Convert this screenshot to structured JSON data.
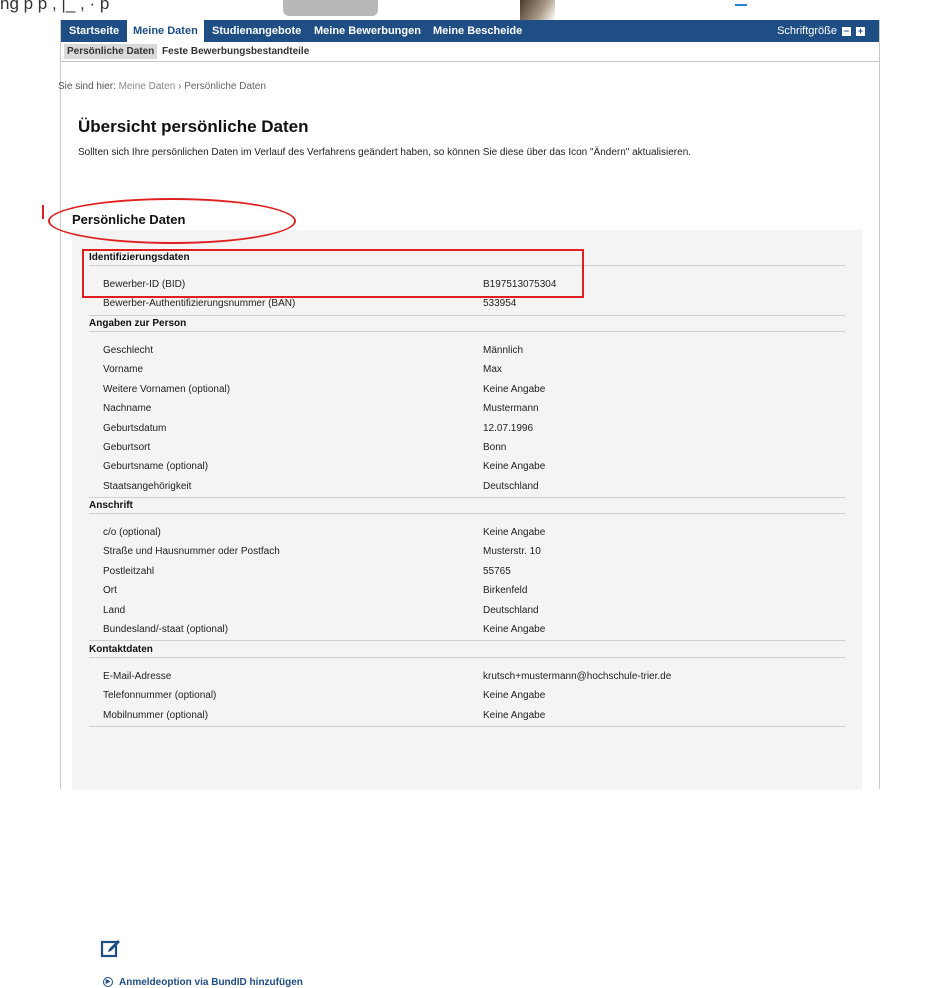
{
  "top_strip": {
    "partial_text": "ng  p                                                  p      ,      |_                 ,  ·                                  p"
  },
  "nav": {
    "items": [
      "Startseite",
      "Meine Daten",
      "Studienangebote",
      "Meine Bewerbungen",
      "Meine Bescheide"
    ],
    "active": "Meine Daten",
    "font_size_label": "Schriftgröße",
    "font_minus": "−",
    "font_plus": "+"
  },
  "subnav": {
    "items": [
      "Persönliche Daten",
      "Feste Bewerbungsbestandteile"
    ],
    "active": "Persönliche Daten"
  },
  "breadcrumb": {
    "label": "Sie sind hier:",
    "items": [
      "Meine Daten",
      "Persönliche Daten"
    ],
    "separator": "›"
  },
  "page": {
    "title": "Übersicht persönliche Daten",
    "intro": "Sollten sich Ihre persönlichen Daten im Verlauf des Verfahrens geändert haben, so können Sie diese über das Icon \"Ändern\" aktualisieren.",
    "section_title": "Persönliche Daten"
  },
  "groups": [
    {
      "title": "Identifizierungsdaten",
      "rows": [
        {
          "k": "Bewerber-ID (BID)",
          "v": "B197513075304"
        },
        {
          "k": "Bewerber-Authentifizierungsnummer (BAN)",
          "v": "533954"
        }
      ]
    },
    {
      "title": "Angaben zur Person",
      "rows": [
        {
          "k": "Geschlecht",
          "v": "Männlich"
        },
        {
          "k": "Vorname",
          "v": "Max"
        },
        {
          "k": "Weitere Vornamen (optional)",
          "v": "Keine Angabe"
        },
        {
          "k": "Nachname",
          "v": "Mustermann"
        },
        {
          "k": "Geburtsdatum",
          "v": "12.07.1996"
        },
        {
          "k": "Geburtsort",
          "v": "Bonn"
        },
        {
          "k": "Geburtsname (optional)",
          "v": "Keine Angabe"
        },
        {
          "k": "Staatsangehörigkeit",
          "v": "Deutschland"
        }
      ]
    },
    {
      "title": "Anschrift",
      "rows": [
        {
          "k": "c/o (optional)",
          "v": "Keine Angabe"
        },
        {
          "k": "Straße und Hausnummer oder Postfach",
          "v": "Musterstr. 10"
        },
        {
          "k": "Postleitzahl",
          "v": "55765"
        },
        {
          "k": "Ort",
          "v": "Birkenfeld"
        },
        {
          "k": "Land",
          "v": "Deutschland"
        },
        {
          "k": "Bundesland/-staat (optional)",
          "v": "Keine Angabe"
        }
      ]
    },
    {
      "title": "Kontaktdaten",
      "rows": [
        {
          "k": "E-Mail-Adresse",
          "v": "krutsch+mustermann@hochschule-trier.de"
        },
        {
          "k": "Telefonnummer (optional)",
          "v": "Keine Angabe"
        },
        {
          "k": "Mobilnummer (optional)",
          "v": "Keine Angabe"
        }
      ]
    }
  ],
  "actions": {
    "edit_icon": "edit-icon",
    "bundid_link": "Anmeldeoption via BundID hinzufügen"
  },
  "colors": {
    "nav_bg": "#1f4e85",
    "annotation_red": "#e02020",
    "panel_bg": "#f4f4f4"
  }
}
